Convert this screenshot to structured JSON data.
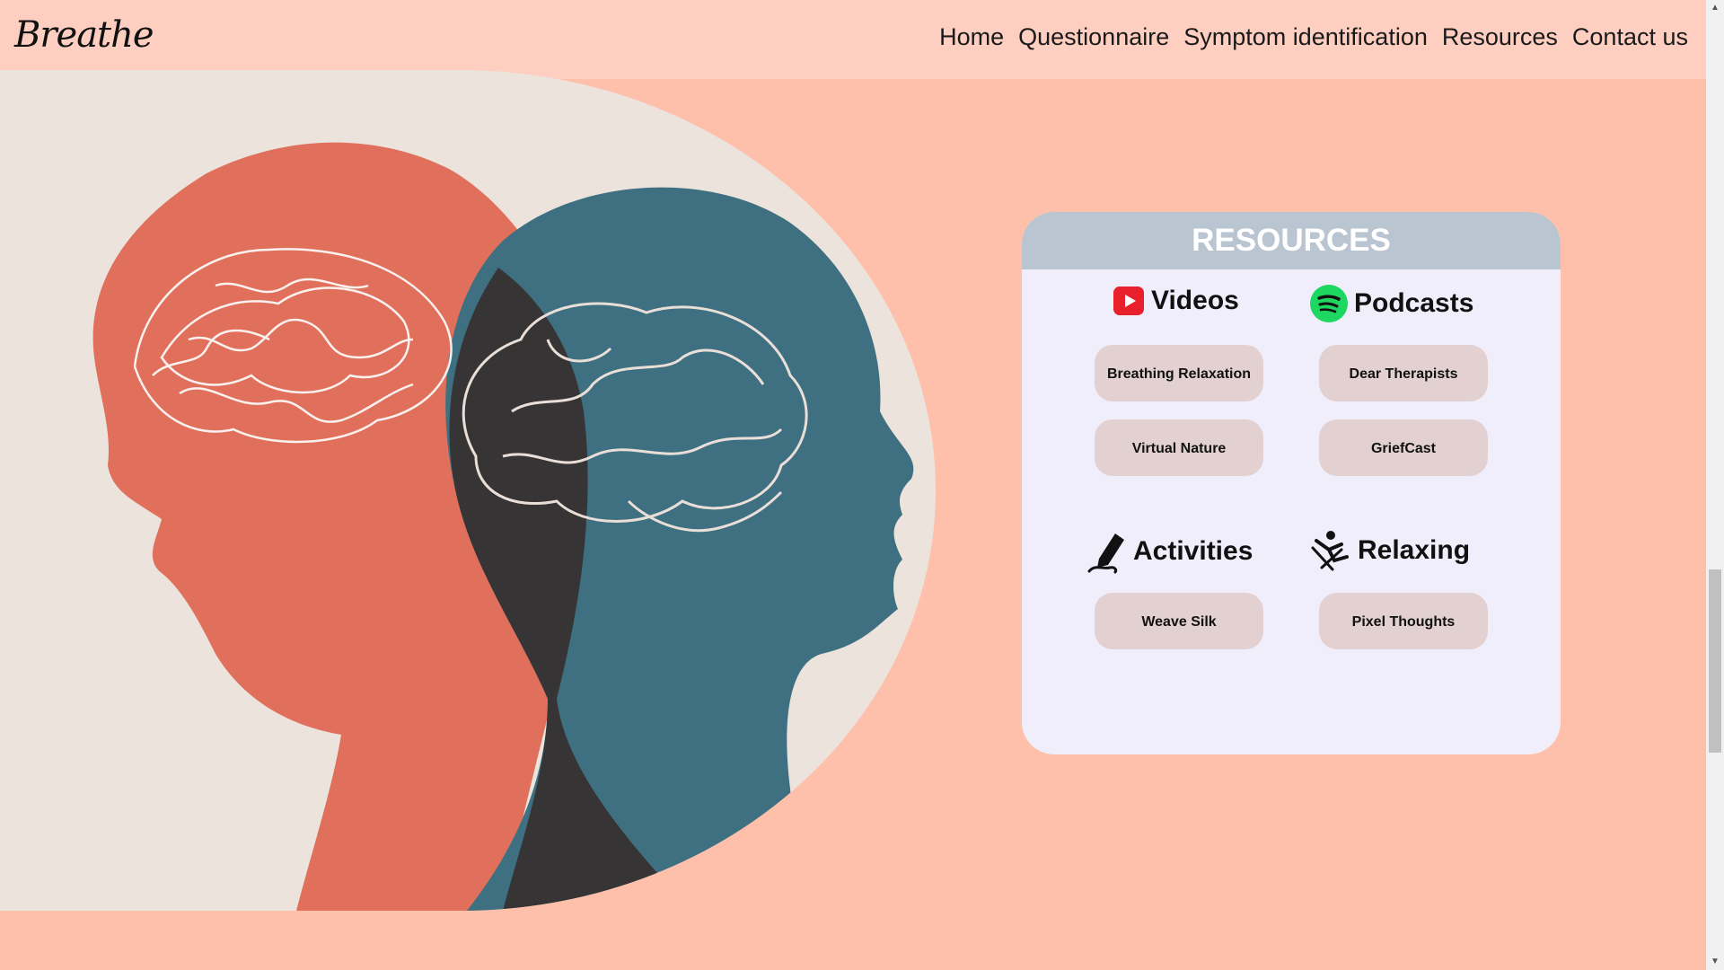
{
  "navbar": {
    "brand": "Breathe",
    "links": [
      "Home",
      "Questionnaire",
      "Symptom identification",
      "Resources",
      "Contact us"
    ]
  },
  "resources": {
    "title": "RESOURCES",
    "sections": [
      {
        "title": "Videos",
        "icon": "youtube-icon",
        "items": [
          "Breathing Relaxation",
          "Virtual Nature"
        ]
      },
      {
        "title": "Podcasts",
        "icon": "spotify-icon",
        "items": [
          "Dear Therapists",
          "GriefCast"
        ]
      },
      {
        "title": "Activities",
        "icon": "pen-icon",
        "items": [
          "Weave Silk"
        ]
      },
      {
        "title": "Relaxing",
        "icon": "relaxing-person-icon",
        "items": [
          "Pixel Thoughts"
        ]
      }
    ]
  },
  "colors": {
    "page_background": "#fec0aa",
    "navbar_background": "#fecfc0",
    "card_background": "#f0eefb",
    "card_header": "#b9c5d0",
    "button_background": "#e3d1d2",
    "head_left": "#e0705c",
    "head_right": "#3f7081"
  }
}
